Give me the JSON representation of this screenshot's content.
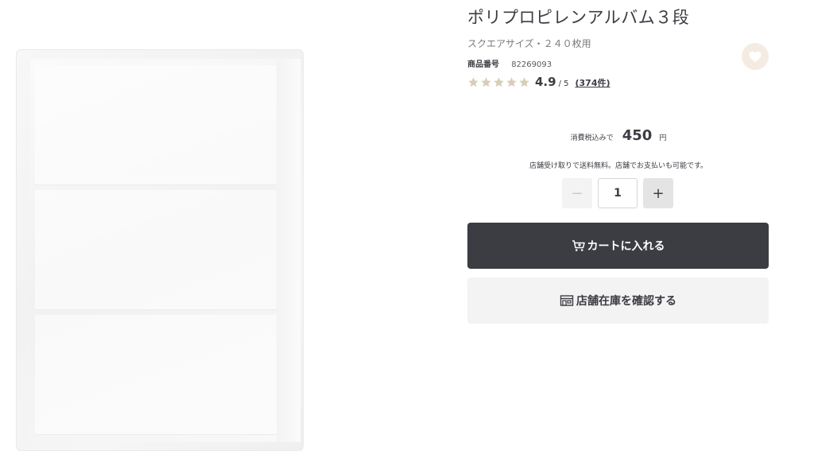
{
  "product": {
    "title": "ポリプロピレンアルバム３段",
    "subtitle": "スクエアサイズ・２４０枚用",
    "code_label": "商品番号",
    "code_value": "82269093",
    "image_alt": "ポリプロピレンアルバム３段"
  },
  "favorite": {
    "icon": "heart-icon"
  },
  "rating": {
    "stars_filled": 5,
    "stars_total": 5,
    "score": "4.9",
    "max": "/ 5",
    "count": "(374件)",
    "star_color": "#d8ceb8"
  },
  "price": {
    "prefix": "消費税込みで",
    "value": "450",
    "unit": "円"
  },
  "shipping_note": "店舗受け取りで送料無料。店舗でお支払いも可能です。",
  "quantity": {
    "value": "1",
    "minus_symbol": "−",
    "plus_symbol": "+"
  },
  "actions": {
    "cart_label": "カートに入れる",
    "cart_icon": "cart-icon",
    "stock_label": "店舗在庫を確認する",
    "stock_icon": "store-icon"
  },
  "colors": {
    "primary_dark": "#3c3c43",
    "favorite_bg": "#f4ece2",
    "secondary_bg": "#f3f3f3"
  }
}
